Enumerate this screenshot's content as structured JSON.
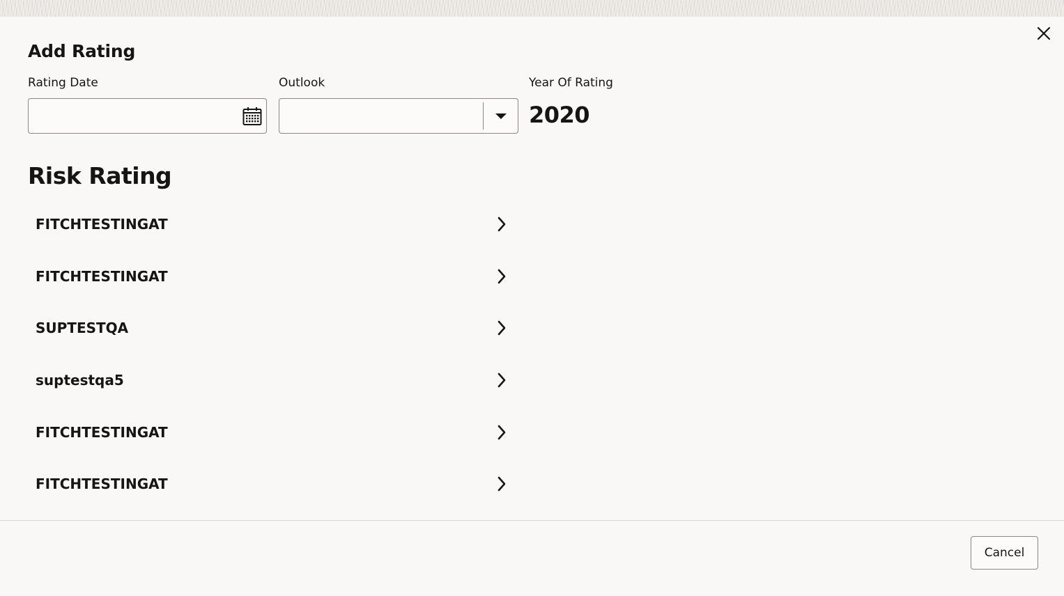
{
  "dialog": {
    "title": "Add Rating",
    "close_icon": "close-icon"
  },
  "form": {
    "rating_date": {
      "label": "Rating Date",
      "value": "",
      "icon": "calendar-icon"
    },
    "outlook": {
      "label": "Outlook",
      "value": "",
      "icon": "caret-down-icon"
    },
    "year_of_rating": {
      "label": "Year Of Rating",
      "value": "2020"
    }
  },
  "risk_rating": {
    "title": "Risk Rating",
    "items": [
      {
        "label": "FITCHTESTINGAT"
      },
      {
        "label": "FITCHTESTINGAT"
      },
      {
        "label": "SUPTESTQA"
      },
      {
        "label": "suptestqa5"
      },
      {
        "label": "FITCHTESTINGAT"
      },
      {
        "label": "FITCHTESTINGAT"
      }
    ],
    "item_icon": "chevron-right-icon"
  },
  "footer": {
    "cancel_label": "Cancel"
  }
}
